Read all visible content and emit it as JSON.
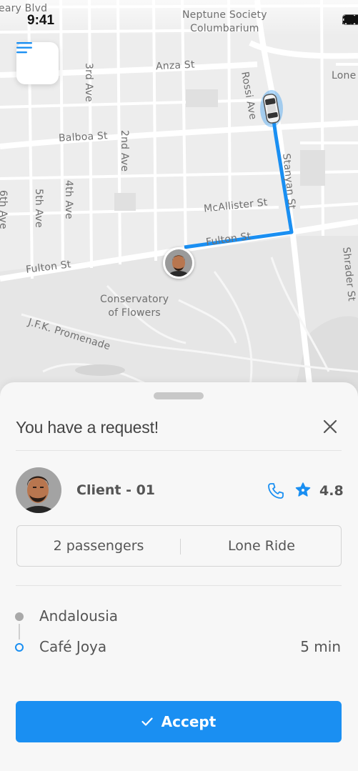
{
  "status_bar": {
    "time": "9:41"
  },
  "map": {
    "labels": {
      "geary": "eary Blvd",
      "neptune": "Neptune Society\nColumbarium",
      "anza": "Anza St",
      "lone": "Lone",
      "third_ave": "3rd Ave",
      "rossi_ave": "Rossi Ave",
      "balboa": "Balboa St",
      "second_ave": "2nd Ave",
      "stanyan": "Stanyan St",
      "fourth_ave": "4th Ave",
      "fifth_ave": "5th Ave",
      "sixth_ave": "6th Ave",
      "mcallister": "McAllister St",
      "fulton_right": "Fulton St",
      "fulton_left": "Fulton St",
      "shrader": "Shrader St",
      "conservatory": "Conservatory\nof Flowers",
      "jfk": "J.F.K. Promenade"
    },
    "route_color": "#1a8ff2"
  },
  "request": {
    "title": "You have a request!",
    "client_name": "Client - 01",
    "rating": "4.8",
    "passengers": "2 passengers",
    "ride_type": "Lone Ride",
    "from": "Andalousia",
    "to": "Café Joya",
    "eta": "5 min",
    "accept_label": "Accept"
  },
  "icons": {
    "menu": "menu-icon",
    "close": "close-icon",
    "phone": "phone-icon",
    "star": "star-icon",
    "check": "check-icon",
    "car": "car-icon"
  },
  "colors": {
    "accent": "#1a8ff2",
    "sheet_bg": "#f7f7f7",
    "map_bg": "#ededed"
  }
}
